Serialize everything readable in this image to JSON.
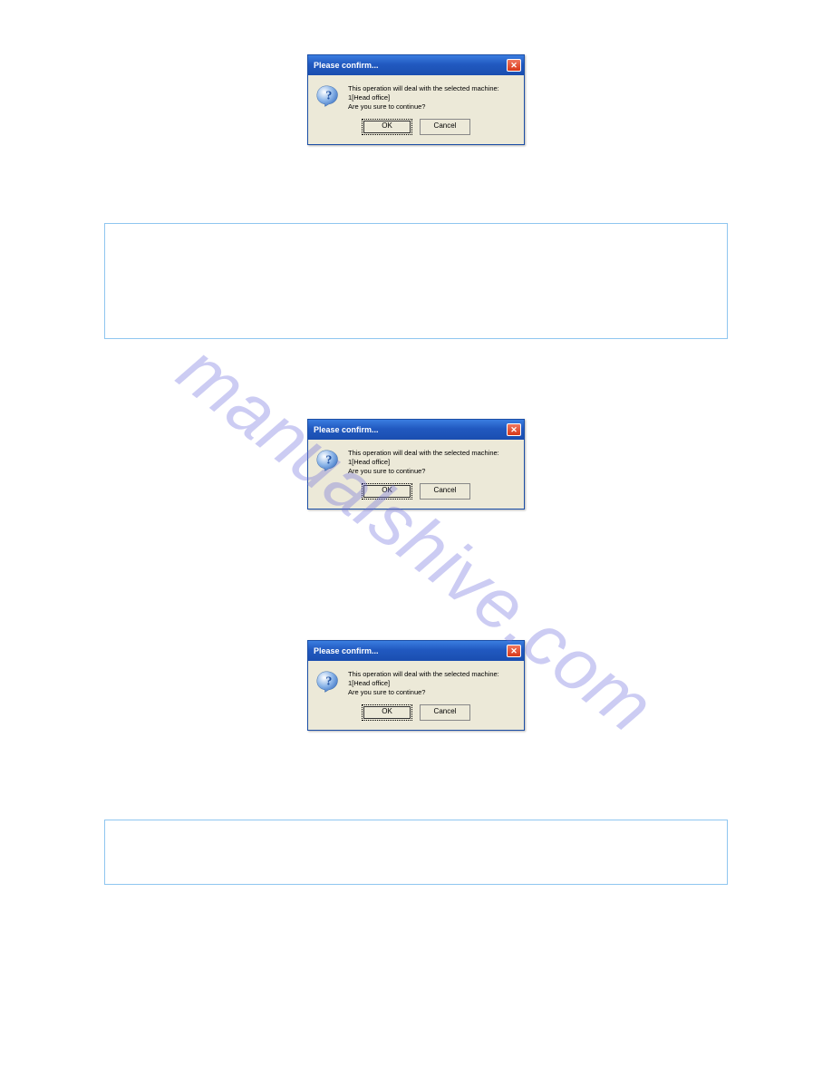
{
  "watermark": "manualshive.com",
  "dialogs": [
    {
      "title": "Please confirm...",
      "line1": "This operation will deal with the selected machine:",
      "line2": "1[Head office]",
      "line3": "Are you sure to continue?",
      "ok": "OK",
      "cancel": "Cancel"
    },
    {
      "title": "Please confirm...",
      "line1": "This operation will deal with the selected machine:",
      "line2": "1[Head office]",
      "line3": "Are you sure to continue?",
      "ok": "OK",
      "cancel": "Cancel"
    },
    {
      "title": "Please confirm...",
      "line1": "This operation will deal with the selected machine:",
      "line2": "1[Head office]",
      "line3": "Are you sure to continue?",
      "ok": "OK",
      "cancel": "Cancel"
    }
  ]
}
